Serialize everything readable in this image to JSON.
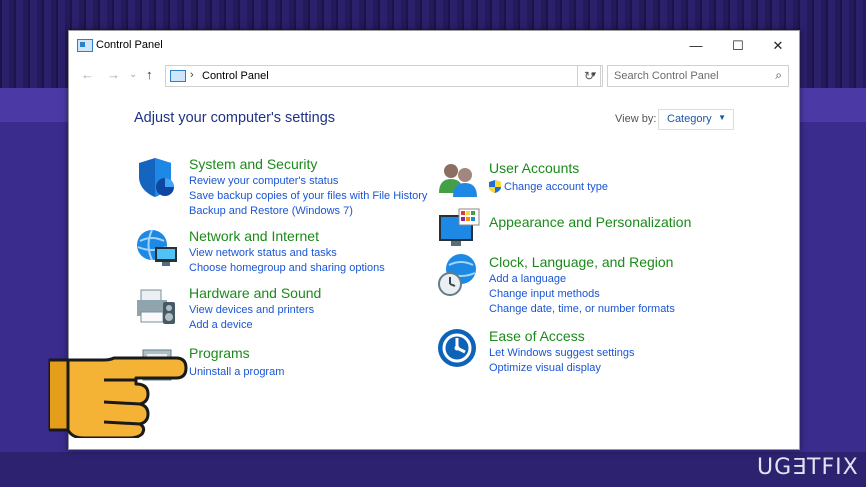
{
  "window": {
    "title": "Control Panel",
    "minimize": "—",
    "maximize": "☐",
    "close": "✕"
  },
  "address": {
    "back": "←",
    "forward": "→",
    "recent": "⌄",
    "up": "↑",
    "separator": "›",
    "path": "Control Panel",
    "dropdown": "▾",
    "refresh": "↻",
    "search_placeholder": "Search Control Panel",
    "search_glyph": "⌕"
  },
  "main": {
    "heading": "Adjust your computer's settings",
    "view_by_label": "View by:",
    "view_by_value": "Category",
    "view_by_arrow": "▼"
  },
  "categories": [
    {
      "title": "System and Security",
      "links": [
        "Review your computer's status",
        "Save backup copies of your files with File History",
        "Backup and Restore (Windows 7)"
      ]
    },
    {
      "title": "Network and Internet",
      "links": [
        "View network status and tasks",
        "Choose homegroup and sharing options"
      ]
    },
    {
      "title": "Hardware and Sound",
      "links": [
        "View devices and printers",
        "Add a device"
      ]
    },
    {
      "title": "Programs",
      "links": [
        "Uninstall a program"
      ]
    },
    {
      "title": "User Accounts",
      "links": [
        "Change account type"
      ]
    },
    {
      "title": "Appearance and Personalization",
      "links": []
    },
    {
      "title": "Clock, Language, and Region",
      "links": [
        "Add a language",
        "Change input methods",
        "Change date, time, or number formats"
      ]
    },
    {
      "title": "Ease of Access",
      "links": [
        "Let Windows suggest settings",
        "Optimize visual display"
      ]
    }
  ],
  "watermark": "UG∃TFIX"
}
